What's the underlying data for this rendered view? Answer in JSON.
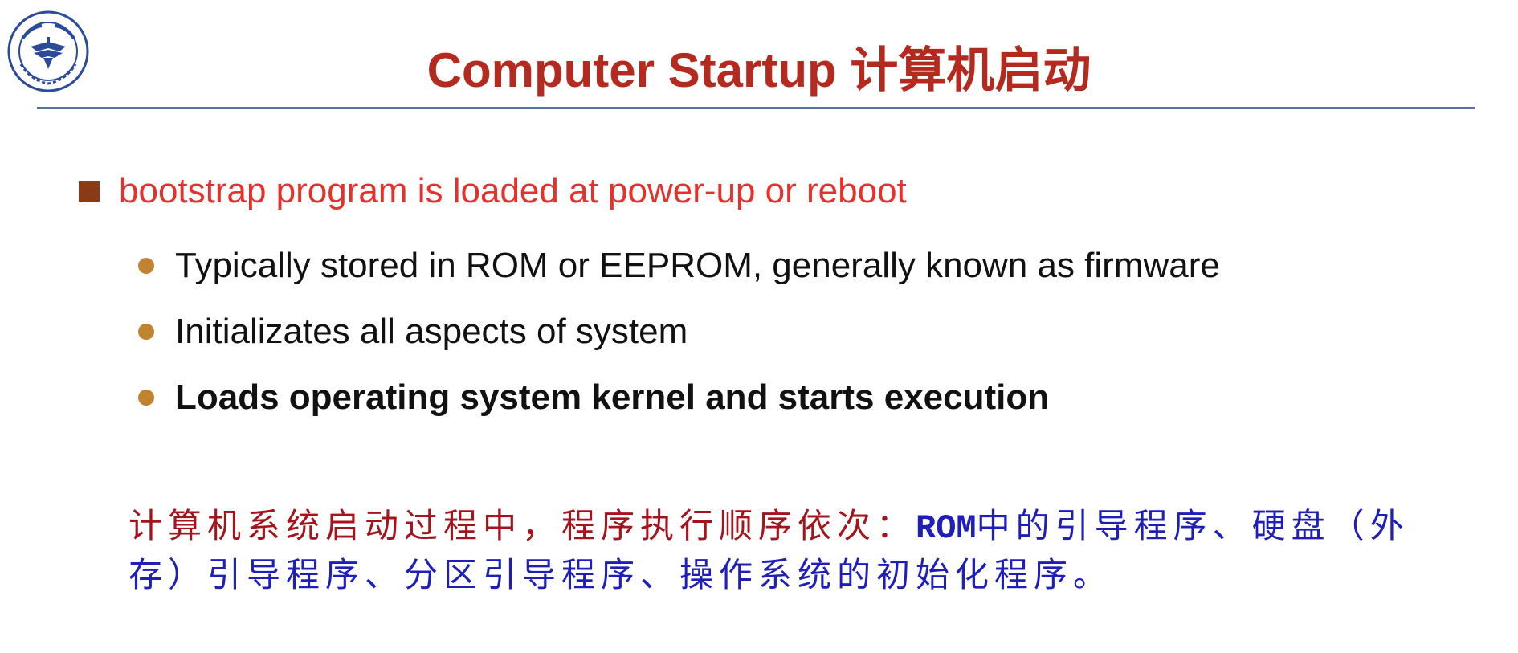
{
  "logo": {
    "icon": "zhejiang-university-seal",
    "seal_text": "ZHEJIANG UNIVERSITY",
    "seal_year": "1897"
  },
  "slide": {
    "title": "Computer Startup 计算机启动",
    "main_bullet": "bootstrap program is loaded at power-up or reboot",
    "sub_bullets": [
      "Typically stored in ROM or EEPROM, generally known as firmware",
      "Initializates all aspects of system",
      "Loads operating system kernel and starts execution"
    ],
    "note": {
      "red_part": "计算机系统启动过程中，程序执行顺序依次：",
      "rom": "ROM",
      "blue_part": "中的引导程序、硬盘（外存）引导程序、分区引导程序、操作系统的初始化程序。"
    }
  },
  "colors": {
    "title": "#b52a1f",
    "rule": "#5a6f9b",
    "main_bullet_text": "#e8302a",
    "square_marker": "#8a3a17",
    "dot_marker": "#c1832f",
    "note_red": "#a3141c",
    "note_blue": "#1f1fb8"
  }
}
